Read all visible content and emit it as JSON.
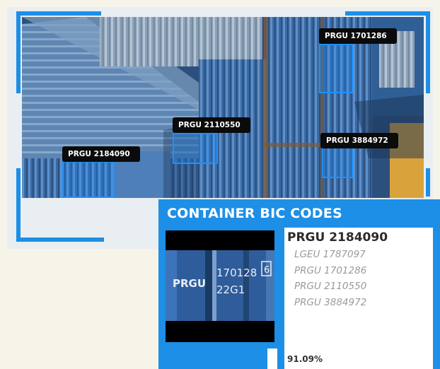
{
  "detections": [
    {
      "code": "PRGU 1701286"
    },
    {
      "code": "PRGU 2110550"
    },
    {
      "code": "PRGU 3884972"
    },
    {
      "code": "PRGU 2184090"
    }
  ],
  "panel": {
    "title": "CONTAINER BIC CODES",
    "primary_code": "PRGU 2184090",
    "candidates": [
      "LGEU 1787097",
      "PRGU 1701286",
      "PRGU 2110550",
      "PRGU 3884972"
    ],
    "confidence_label": "91.09%",
    "confidence_value": 0.9109,
    "crop": {
      "prefix": "PRGU",
      "line1": "170128",
      "line2": "22G1",
      "check": "6"
    }
  },
  "colors": {
    "accent": "#1d8fe6",
    "tag_bg": "#0b0b0b"
  }
}
